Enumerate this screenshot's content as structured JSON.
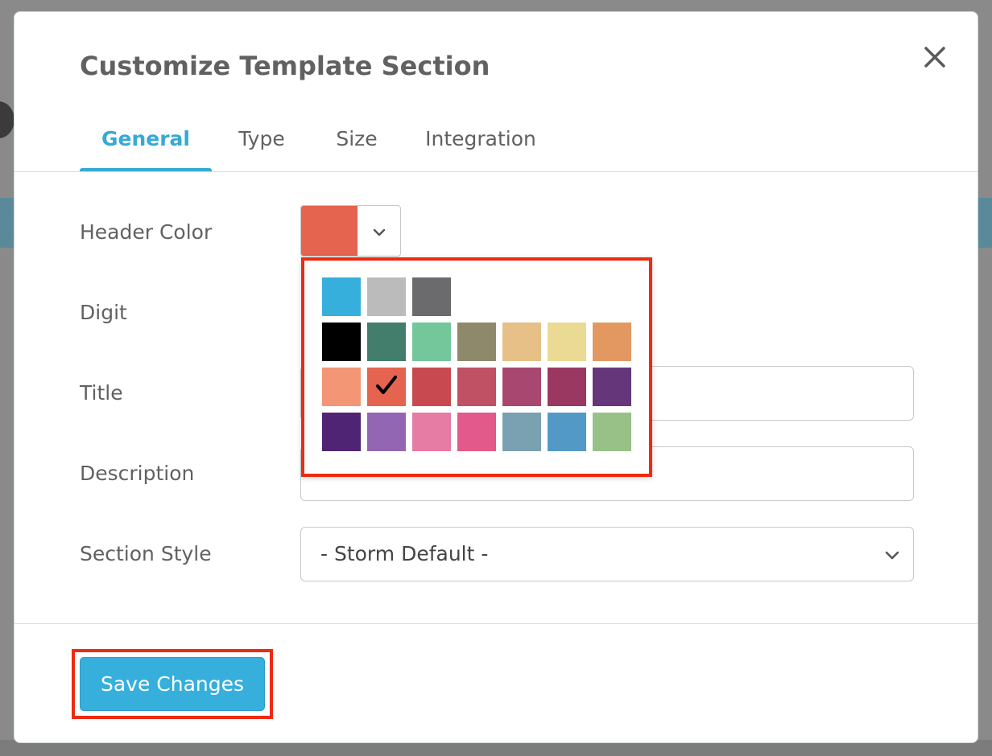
{
  "modal": {
    "title": "Customize Template Section",
    "close_icon": "close-icon"
  },
  "tabs": [
    {
      "label": "General",
      "active": true
    },
    {
      "label": "Type",
      "active": false
    },
    {
      "label": "Size",
      "active": false
    },
    {
      "label": "Integration",
      "active": false
    }
  ],
  "form": {
    "header_color_label": "Header Color",
    "header_color_value": "#e4644f",
    "digit_label": "Digit",
    "title_label": "Title",
    "title_value": "",
    "description_label": "Description",
    "description_value": "",
    "section_style_label": "Section Style",
    "section_style_value": "- Storm Default -"
  },
  "palette": {
    "selected_color": "#e4644f",
    "rows": [
      [
        "#36afdc",
        "#bbbbbb",
        "#6b6b6d"
      ],
      [
        "#000000",
        "#437d6c",
        "#74c79a",
        "#8f896b",
        "#e6c086",
        "#eada94",
        "#e39862"
      ],
      [
        "#f29675",
        "#e4644f",
        "#c84a50",
        "#c05064",
        "#a84870",
        "#9a3862",
        "#66367a"
      ],
      [
        "#4f2474",
        "#9366b4",
        "#e67ba4",
        "#e25a89",
        "#7aa1b2",
        "#5399c6",
        "#98c188"
      ]
    ]
  },
  "footer": {
    "save_label": "Save Changes"
  },
  "colors": {
    "accent": "#36afdc",
    "highlight": "#ee2a12",
    "text": "#616161"
  }
}
